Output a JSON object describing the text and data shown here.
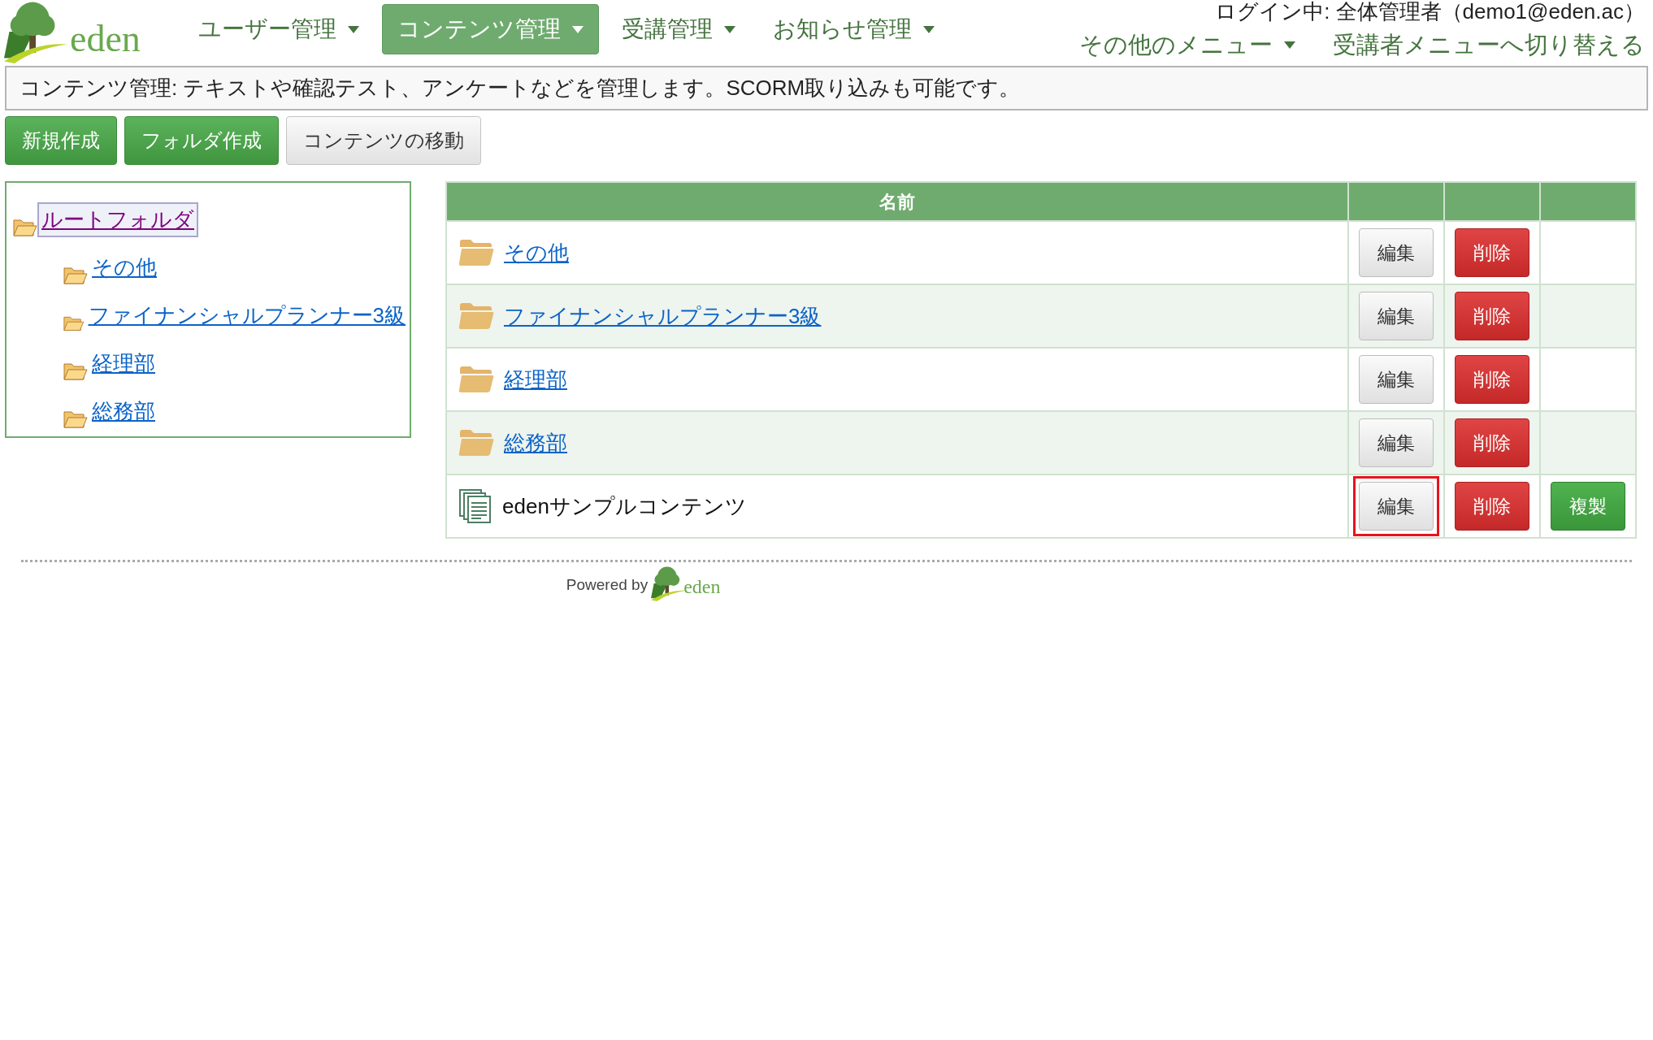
{
  "logo": {
    "text": "eden"
  },
  "nav": [
    {
      "label": "ユーザー管理",
      "selected": false
    },
    {
      "label": "コンテンツ管理",
      "selected": true
    },
    {
      "label": "受講管理",
      "selected": false
    },
    {
      "label": "お知らせ管理",
      "selected": false
    }
  ],
  "login_status": "ログイン中: 全体管理者（demo1@eden.ac）",
  "secondary_nav": [
    {
      "label": "その他のメニュー",
      "kind": "dropdown"
    },
    {
      "label": "受講者メニューへ切り替える",
      "kind": "link"
    }
  ],
  "description": "コンテンツ管理: テキストや確認テスト、アンケートなどを管理します。SCORM取り込みも可能です。",
  "toolbar": [
    {
      "label": "新規作成",
      "kind": "primary"
    },
    {
      "label": "フォルダ作成",
      "kind": "primary"
    },
    {
      "label": "コンテンツの移動",
      "kind": "default"
    }
  ],
  "folder_tree": {
    "label": "ルートフォルダ",
    "selected": true,
    "children": [
      {
        "label": "その他",
        "selected": false
      },
      {
        "label": "ファイナンシャルプランナー3級",
        "selected": false
      },
      {
        "label": "経理部",
        "selected": false
      },
      {
        "label": "総務部",
        "selected": false
      }
    ]
  },
  "table": {
    "columns": [
      "名前"
    ],
    "rows": [
      {
        "kind": "folder",
        "name": "その他",
        "actions": [
          {
            "label": "編集",
            "kind": "edit",
            "highlighted": false
          },
          {
            "label": "削除",
            "kind": "delete",
            "highlighted": false
          }
        ]
      },
      {
        "kind": "folder",
        "name": "ファイナンシャルプランナー3級",
        "actions": [
          {
            "label": "編集",
            "kind": "edit",
            "highlighted": false
          },
          {
            "label": "削除",
            "kind": "delete",
            "highlighted": false
          }
        ]
      },
      {
        "kind": "folder",
        "name": "経理部",
        "actions": [
          {
            "label": "編集",
            "kind": "edit",
            "highlighted": false
          },
          {
            "label": "削除",
            "kind": "delete",
            "highlighted": false
          }
        ]
      },
      {
        "kind": "folder",
        "name": "総務部",
        "actions": [
          {
            "label": "編集",
            "kind": "edit",
            "highlighted": false
          },
          {
            "label": "削除",
            "kind": "delete",
            "highlighted": false
          }
        ]
      },
      {
        "kind": "content",
        "name": "edenサンプルコンテンツ",
        "actions": [
          {
            "label": "編集",
            "kind": "edit",
            "highlighted": true
          },
          {
            "label": "削除",
            "kind": "delete",
            "highlighted": false
          },
          {
            "label": "複製",
            "kind": "copy",
            "highlighted": false
          }
        ]
      }
    ]
  },
  "footer": {
    "powered_by": "Powered by",
    "logo_text": "eden"
  }
}
